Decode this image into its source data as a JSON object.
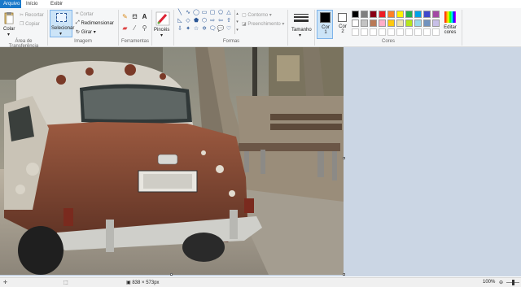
{
  "tabs": {
    "file": "Arquivo",
    "home": "Início",
    "view": "Exibir"
  },
  "clipboard": {
    "paste": "Colar",
    "cut": "Recortar",
    "copy": "Copiar",
    "label": "Área de Transferência"
  },
  "image": {
    "select": "Selecionar",
    "crop": "Cortar",
    "resize": "Redimensionar",
    "rotate": "Girar",
    "label": "Imagem"
  },
  "tools": {
    "label": "Ferramentas"
  },
  "brushes": {
    "label": "Pincéis"
  },
  "shapes": {
    "outline": "Contorno",
    "fill": "Preenchimento",
    "label": "Formas"
  },
  "size": {
    "label": "Tamanho"
  },
  "colors": {
    "color1": "Cor 1",
    "color2": "Cor 2",
    "edit": "Editar cores",
    "label": "Cores",
    "row1": [
      "#000000",
      "#7f7f7f",
      "#880015",
      "#ed1c24",
      "#ff7f27",
      "#fff200",
      "#22b14c",
      "#00a2e8",
      "#3f48cc",
      "#a349a4"
    ],
    "row2": [
      "#ffffff",
      "#c3c3c3",
      "#b97a57",
      "#ffaec9",
      "#ffc90e",
      "#efe4b0",
      "#b5e61d",
      "#99d9ea",
      "#7092be",
      "#c8bfe7"
    ],
    "row3": [
      "#ffffff",
      "#ffffff",
      "#ffffff",
      "#ffffff",
      "#ffffff",
      "#ffffff",
      "#ffffff",
      "#ffffff",
      "#ffffff",
      "#ffffff"
    ]
  },
  "status": {
    "dimensions": "838 × 573px",
    "zoom": "100%"
  }
}
